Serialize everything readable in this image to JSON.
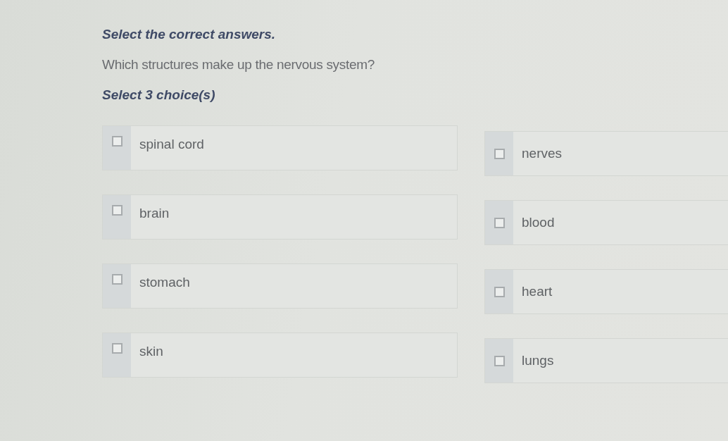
{
  "instruction": "Select the correct answers.",
  "question": "Which structures make up the nervous system?",
  "prompt": "Select 3 choice(s)",
  "options": [
    {
      "label": "spinal cord",
      "checked": false
    },
    {
      "label": "nerves",
      "checked": false
    },
    {
      "label": "brain",
      "checked": false
    },
    {
      "label": "blood",
      "checked": false
    },
    {
      "label": "stomach",
      "checked": false
    },
    {
      "label": "heart",
      "checked": false
    },
    {
      "label": "skin",
      "checked": false
    },
    {
      "label": "lungs",
      "checked": false
    }
  ]
}
